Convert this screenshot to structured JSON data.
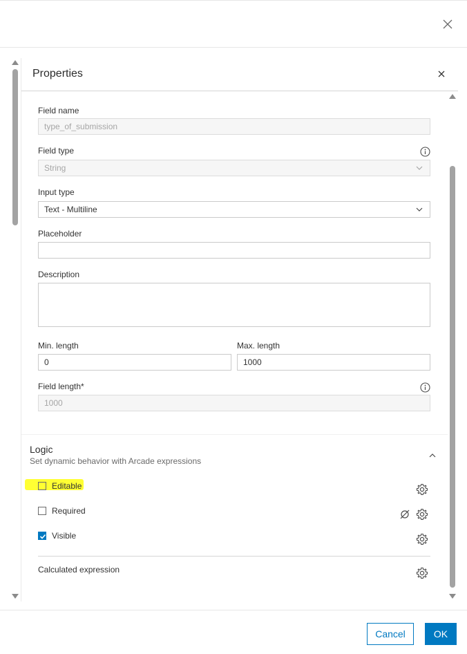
{
  "dialog": {
    "close_icon": "close-icon"
  },
  "properties": {
    "title": "Properties",
    "close_icon": "close-icon"
  },
  "form": {
    "field_name_label": "Field name",
    "field_name_value": "type_of_submission",
    "field_type_label": "Field type",
    "field_type_value": "String",
    "input_type_label": "Input type",
    "input_type_value": "Text - Multiline",
    "placeholder_label": "Placeholder",
    "placeholder_value": "",
    "description_label": "Description",
    "description_value": "",
    "min_length_label": "Min. length",
    "min_length_value": "0",
    "max_length_label": "Max. length",
    "max_length_value": "1000",
    "field_length_label": "Field length*",
    "field_length_value": "1000"
  },
  "logic": {
    "title": "Logic",
    "subtitle": "Set dynamic behavior with Arcade expressions",
    "items": [
      {
        "label": "Editable",
        "checked": false
      },
      {
        "label": "Required",
        "checked": false
      },
      {
        "label": "Visible",
        "checked": true
      }
    ],
    "calculated_label": "Calculated expression"
  },
  "footer": {
    "cancel_label": "Cancel",
    "ok_label": "OK"
  },
  "colors": {
    "accent": "#0079c1",
    "highlight": "#ffff33"
  }
}
